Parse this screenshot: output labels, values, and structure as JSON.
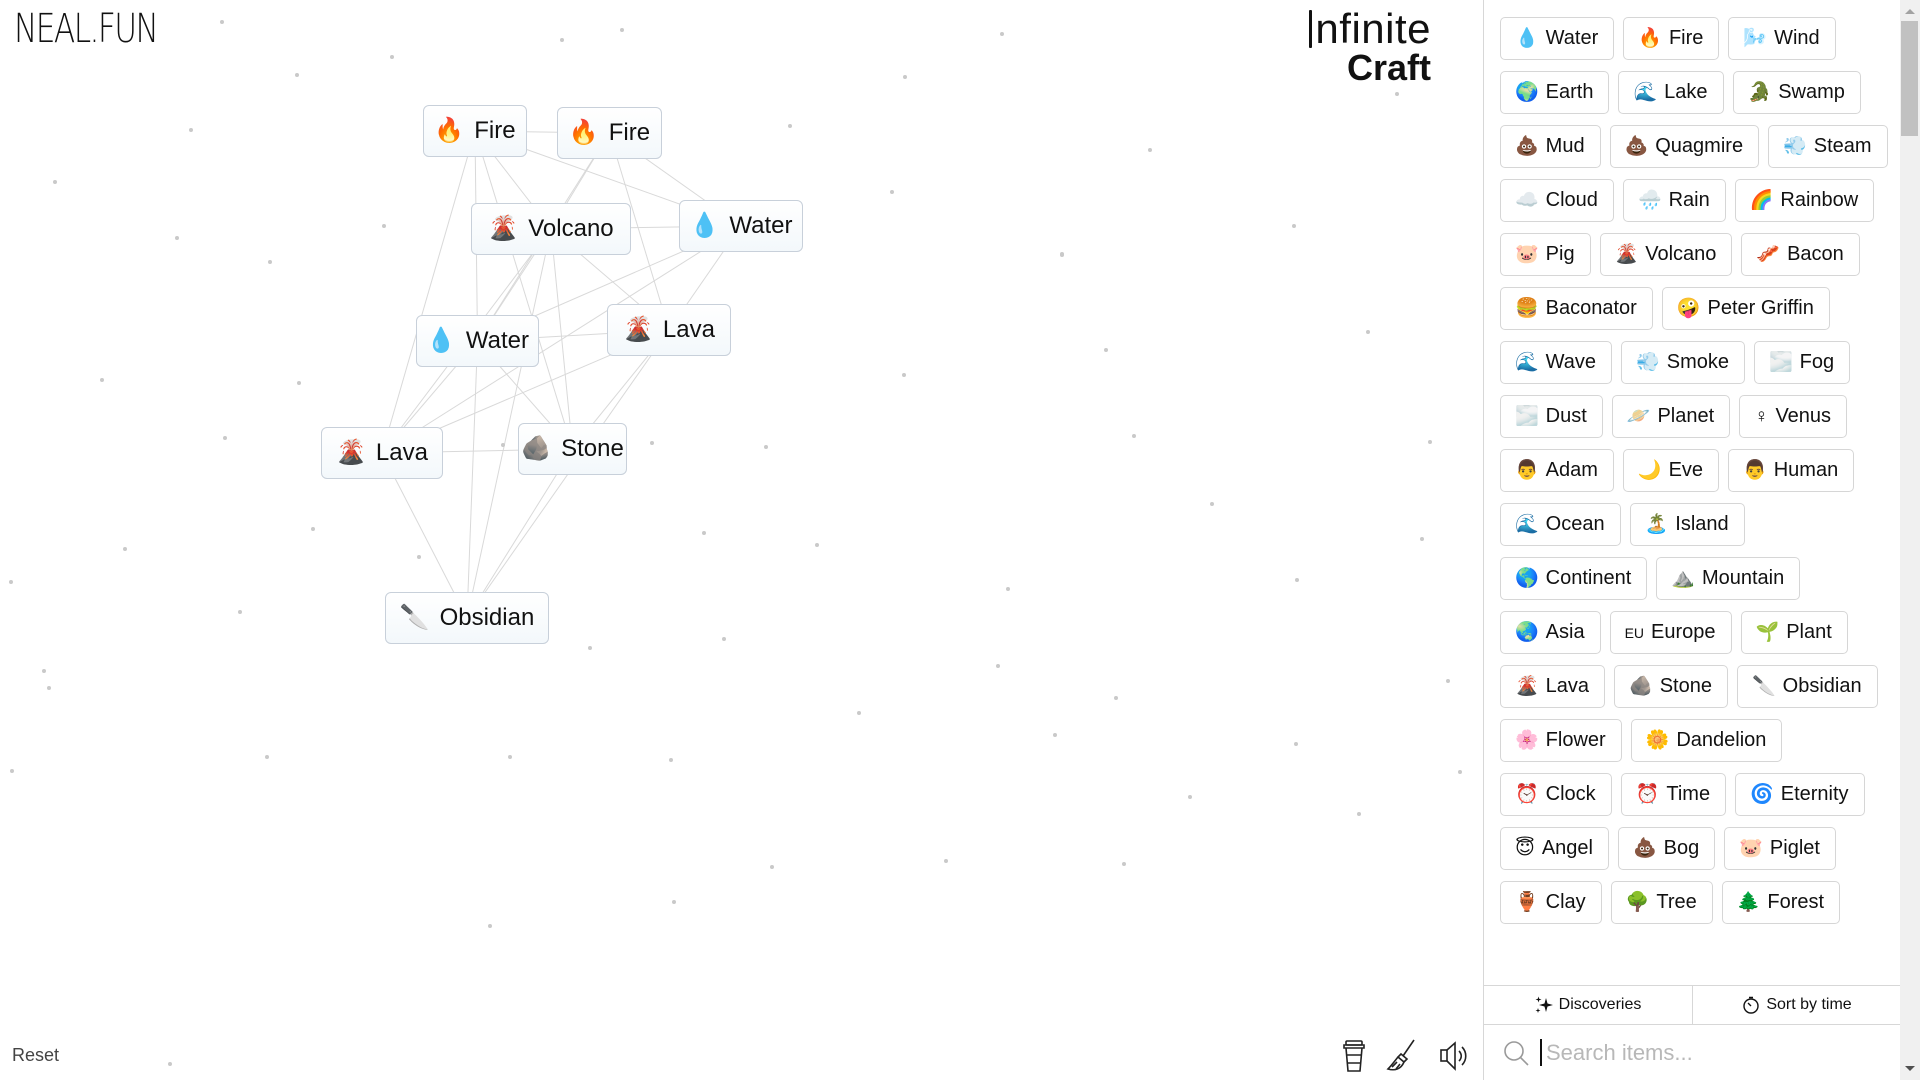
{
  "branding": {
    "site_logo": "NEAL.FUN",
    "game_title_line1": "nfinite",
    "game_title_line2": "Craft"
  },
  "canvas": {
    "nodes": [
      {
        "id": "fire-1",
        "label": "Fire",
        "emoji": "🔥"
      },
      {
        "id": "fire-2",
        "label": "Fire",
        "emoji": "🔥"
      },
      {
        "id": "volcano",
        "label": "Volcano",
        "emoji": "🌋"
      },
      {
        "id": "water-1",
        "label": "Water",
        "emoji": "💧"
      },
      {
        "id": "water-2",
        "label": "Water",
        "emoji": "💧"
      },
      {
        "id": "lava-1",
        "label": "Lava",
        "emoji": "🌋"
      },
      {
        "id": "lava-2",
        "label": "Lava",
        "emoji": "🌋"
      },
      {
        "id": "stone",
        "label": "Stone",
        "emoji": "🪨"
      },
      {
        "id": "obsidian",
        "label": "Obsidian",
        "emoji": "🔪"
      }
    ],
    "links": [
      [
        "fire-1",
        "fire-2"
      ],
      [
        "fire-1",
        "volcano"
      ],
      [
        "fire-1",
        "water-1"
      ],
      [
        "fire-1",
        "lava-2"
      ],
      [
        "fire-1",
        "water-2"
      ],
      [
        "fire-1",
        "stone"
      ],
      [
        "fire-2",
        "volcano"
      ],
      [
        "fire-2",
        "water-1"
      ],
      [
        "fire-2",
        "lava-1"
      ],
      [
        "fire-2",
        "water-2"
      ],
      [
        "volcano",
        "water-1"
      ],
      [
        "volcano",
        "water-2"
      ],
      [
        "volcano",
        "lava-1"
      ],
      [
        "volcano",
        "stone"
      ],
      [
        "volcano",
        "lava-2"
      ],
      [
        "water-1",
        "lava-2"
      ],
      [
        "water-1",
        "water-2"
      ],
      [
        "water-1",
        "lava-1"
      ],
      [
        "water-2",
        "lava-1"
      ],
      [
        "water-2",
        "stone"
      ],
      [
        "water-2",
        "lava-2"
      ],
      [
        "water-2",
        "obsidian"
      ],
      [
        "lava-1",
        "stone"
      ],
      [
        "lava-1",
        "lava-2"
      ],
      [
        "lava-1",
        "obsidian"
      ],
      [
        "lava-2",
        "stone"
      ],
      [
        "lava-2",
        "obsidian"
      ],
      [
        "stone",
        "obsidian"
      ],
      [
        "volcano",
        "obsidian"
      ]
    ]
  },
  "controls": {
    "reset_label": "Reset",
    "tools": [
      {
        "name": "coffee-cup-icon",
        "title": "Support"
      },
      {
        "name": "broom-icon",
        "title": "Clear"
      },
      {
        "name": "speaker-icon",
        "title": "Sound"
      }
    ]
  },
  "sidebar": {
    "items": [
      {
        "label": "Water",
        "emoji": "💧"
      },
      {
        "label": "Fire",
        "emoji": "🔥"
      },
      {
        "label": "Wind",
        "emoji": "🌬️"
      },
      {
        "label": "Earth",
        "emoji": "🌍"
      },
      {
        "label": "Lake",
        "emoji": "🌊"
      },
      {
        "label": "Swamp",
        "emoji": "🐊"
      },
      {
        "label": "Mud",
        "emoji": "💩"
      },
      {
        "label": "Quagmire",
        "emoji": "💩"
      },
      {
        "label": "Steam",
        "emoji": "💨"
      },
      {
        "label": "Cloud",
        "emoji": "☁️"
      },
      {
        "label": "Rain",
        "emoji": "🌧️"
      },
      {
        "label": "Rainbow",
        "emoji": "🌈"
      },
      {
        "label": "Pig",
        "emoji": "🐷"
      },
      {
        "label": "Volcano",
        "emoji": "🌋"
      },
      {
        "label": "Bacon",
        "emoji": "🥓"
      },
      {
        "label": "Baconator",
        "emoji": "🍔"
      },
      {
        "label": "Peter Griffin",
        "emoji": "🤪"
      },
      {
        "label": "Wave",
        "emoji": "🌊"
      },
      {
        "label": "Smoke",
        "emoji": "💨"
      },
      {
        "label": "Fog",
        "emoji": "🌫️"
      },
      {
        "label": "Dust",
        "emoji": "🌫️"
      },
      {
        "label": "Planet",
        "emoji": "🪐"
      },
      {
        "label": "Venus",
        "emoji": "♀"
      },
      {
        "label": "Adam",
        "emoji": "👨"
      },
      {
        "label": "Eve",
        "emoji": "🌙"
      },
      {
        "label": "Human",
        "emoji": "👨"
      },
      {
        "label": "Ocean",
        "emoji": "🌊"
      },
      {
        "label": "Island",
        "emoji": "🏝️"
      },
      {
        "label": "Continent",
        "emoji": "🌎"
      },
      {
        "label": "Mountain",
        "emoji": "⛰️"
      },
      {
        "label": "Asia",
        "emoji": "🌏"
      },
      {
        "label": "Europe",
        "emoji": "EU"
      },
      {
        "label": "Plant",
        "emoji": "🌱"
      },
      {
        "label": "Lava",
        "emoji": "🌋"
      },
      {
        "label": "Stone",
        "emoji": "🪨"
      },
      {
        "label": "Obsidian",
        "emoji": "🔪"
      },
      {
        "label": "Flower",
        "emoji": "🌸"
      },
      {
        "label": "Dandelion",
        "emoji": "🌼"
      },
      {
        "label": "Clock",
        "emoji": "⏰"
      },
      {
        "label": "Time",
        "emoji": "⏰"
      },
      {
        "label": "Eternity",
        "emoji": "🌀"
      },
      {
        "label": "Angel",
        "emoji": "😇"
      },
      {
        "label": "Bog",
        "emoji": "💩"
      },
      {
        "label": "Piglet",
        "emoji": "🐷"
      },
      {
        "label": "Clay",
        "emoji": "🏺"
      },
      {
        "label": "Tree",
        "emoji": "🌳"
      },
      {
        "label": "Forest",
        "emoji": "🌲"
      }
    ],
    "tabs": {
      "discoveries_label": "Discoveries",
      "sort_label": "Sort by time"
    },
    "search": {
      "placeholder": "Search items...",
      "value": ""
    }
  }
}
